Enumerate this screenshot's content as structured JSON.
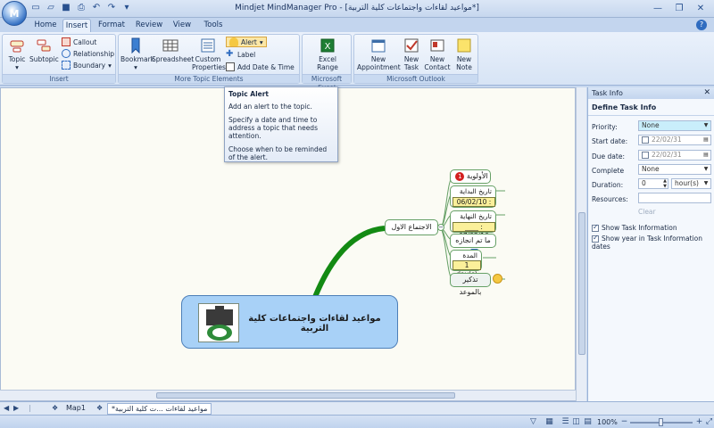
{
  "window": {
    "title": "Mindjet MindManager Pro - [مواعيد لقاءات واجتماعات كلية التربية*]"
  },
  "tabs": [
    "Home",
    "Insert",
    "Format",
    "Review",
    "View",
    "Tools"
  ],
  "active_tab": "Insert",
  "ribbon": {
    "insert_group": {
      "label": "Insert",
      "topic": "Topic",
      "subtopic": "Subtopic",
      "callout": "Callout",
      "relationship": "Relationship",
      "boundary": "Boundary"
    },
    "more_group": {
      "label": "More Topic Elements",
      "bookmark": "Bookmark",
      "spreadsheet": "Spreadsheet",
      "custom_properties_1": "Custom",
      "custom_properties_2": "Properties",
      "alert": "Alert",
      "label_btn": "Label",
      "add_date_time": "Add Date & Time"
    },
    "excel_group": {
      "label": "Microsoft Excel",
      "excel_range_1": "Excel",
      "excel_range_2": "Range"
    },
    "outlook_group": {
      "label": "Microsoft Outlook",
      "new_appointment_1": "New",
      "new_appointment_2": "Appointment",
      "new_task_1": "New",
      "new_task_2": "Task",
      "new_contact_1": "New",
      "new_contact_2": "Contact",
      "new_note_1": "New",
      "new_note_2": "Note"
    }
  },
  "tooltip": {
    "title": "Topic Alert",
    "line1": "Add an alert to the topic.",
    "line2": "Specify a date and time to address a topic that needs attention.",
    "line3": "Choose when to be reminded of the alert."
  },
  "mindmap": {
    "central": "مواعيد لقاءات واجتماعات كلية التربية",
    "main_topic": "الاجتماع الاول",
    "priority_label": "الأولوية",
    "priority_value": "1",
    "start_label": "تاريخ البداية",
    "start_value": "06/02/10 : ____",
    "end_label": "تاريخ النهاية",
    "end_value": "____ : 07/02/10",
    "complete_label": "ما تم انجازه",
    "duration_label": "المدة",
    "duration_value": "1 day(s)",
    "reminder_label": "تذكير بالموعد"
  },
  "task_pane": {
    "title": "Task Info",
    "subtitle": "Define Task Info",
    "priority_label": "Priority:",
    "priority_value": "None",
    "start_label": "Start date:",
    "start_value": "22/02/31",
    "due_label": "Due date:",
    "due_value": "22/02/31",
    "complete_label": "Complete",
    "complete_value": "None",
    "duration_label": "Duration:",
    "duration_value": "0",
    "duration_unit": "hour(s)",
    "resources_label": "Resources:",
    "clear_label": "Clear",
    "show_task_info": "Show Task Information",
    "show_year": "Show year in Task Information dates"
  },
  "sheets": {
    "map1": "Map1",
    "active": "مواعيد لقاءات ...ت كلية التربية*"
  },
  "status": {
    "zoom": "100%"
  },
  "colors": {
    "central_fill": "#a8d1f7",
    "branch_green": "#138a13",
    "meta_yellow": "#fbf09a",
    "priority_red": "#d32020"
  }
}
